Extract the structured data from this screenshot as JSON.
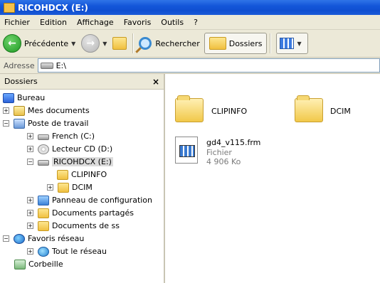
{
  "window": {
    "title": "RICOHDCX (E:)"
  },
  "menu": [
    "Fichier",
    "Edition",
    "Affichage",
    "Favoris",
    "Outils",
    "?"
  ],
  "toolbar": {
    "back_label": "Précédente",
    "search_label": "Rechercher",
    "folders_label": "Dossiers"
  },
  "address": {
    "label": "Adresse",
    "value": "E:\\"
  },
  "left_pane": {
    "title": "Dossiers",
    "close": "×",
    "tree": [
      {
        "label": "Bureau"
      },
      {
        "label": "Mes documents",
        "expander": "+"
      },
      {
        "label": "Poste de travail",
        "expander": "−"
      },
      {
        "label": "French (C:)",
        "expander": "+"
      },
      {
        "label": "Lecteur CD (D:)",
        "expander": "+"
      },
      {
        "label": "RICOHDCX (E:)",
        "expander": "−",
        "selected": true
      },
      {
        "label": "CLIPINFO"
      },
      {
        "label": "DCIM",
        "expander": "+"
      },
      {
        "label": "Panneau de configuration",
        "expander": "+"
      },
      {
        "label": "Documents partagés",
        "expander": "+"
      },
      {
        "label": "Documents de ss",
        "expander": "+"
      },
      {
        "label": "Favoris réseau",
        "expander": "−"
      },
      {
        "label": "Tout le réseau",
        "expander": "+"
      },
      {
        "label": "Corbeille"
      }
    ]
  },
  "content": {
    "folders": [
      "CLIPINFO",
      "DCIM"
    ],
    "file": {
      "name": "gd4_v115.frm",
      "type": "Fichier",
      "size": "4 906 Ko"
    }
  }
}
